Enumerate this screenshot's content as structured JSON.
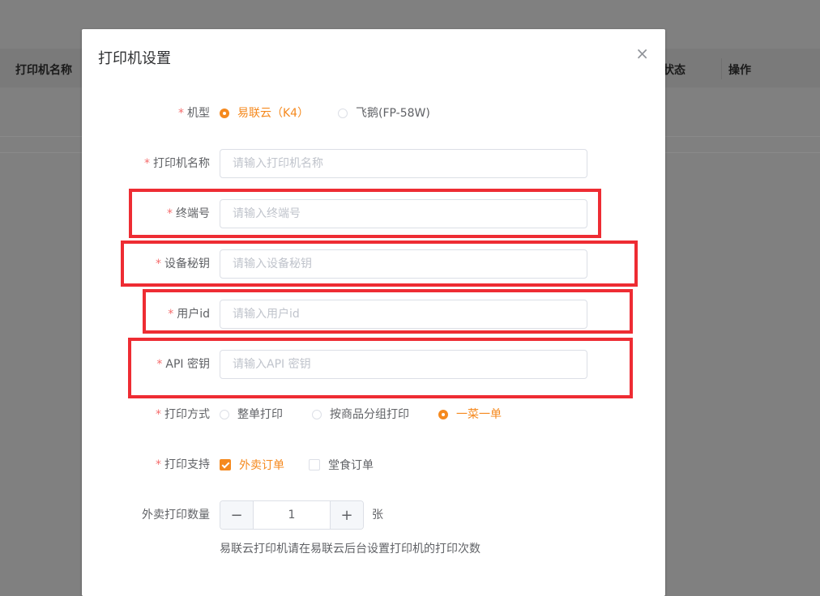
{
  "background": {
    "columns": [
      "打印机名称",
      "状态",
      "操作"
    ]
  },
  "dialog": {
    "title": "打印机设置",
    "close_symbol": "×",
    "model": {
      "label": "机型",
      "options": [
        "易联云（K4）",
        "飞鹅(FP-58W)"
      ],
      "selected": "易联云（K4）"
    },
    "printer_name": {
      "label": "打印机名称",
      "placeholder": "请输入打印机名称"
    },
    "terminal_no": {
      "label": "终端号",
      "placeholder": "请输入终端号"
    },
    "device_key": {
      "label": "设备秘钥",
      "placeholder": "请输入设备秘钥"
    },
    "user_id": {
      "label": "用户id",
      "placeholder": "请输入用户id"
    },
    "api_key": {
      "label": "API 密钥",
      "placeholder": "请输入API 密钥"
    },
    "print_mode": {
      "label": "打印方式",
      "options": [
        "整单打印",
        "按商品分组打印",
        "一菜一单"
      ],
      "selected": "一菜一单"
    },
    "print_support": {
      "label": "打印支持",
      "options": [
        "外卖订单",
        "堂食订单"
      ],
      "checked": [
        "外卖订单"
      ]
    },
    "takeout_copies": {
      "label": "外卖打印数量",
      "value": "1",
      "unit": "张",
      "minus": "−",
      "plus": "+",
      "hint": "易联云打印机请在易联云后台设置打印机的打印次数"
    }
  },
  "colors": {
    "accent": "#f5891e",
    "required": "#f56c6c",
    "highlight": "#ee2c33"
  }
}
